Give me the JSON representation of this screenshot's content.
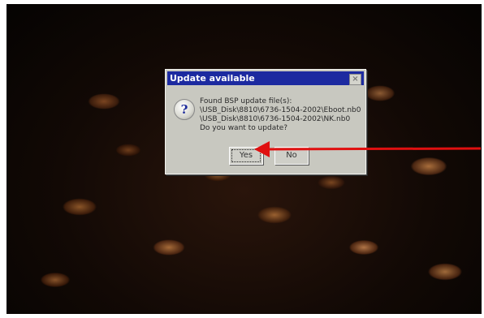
{
  "dialog": {
    "title": "Update available",
    "close_label": "×",
    "icon": "question-icon",
    "lines": [
      "Found BSP update file(s):",
      "\\USB_Disk\\8810\\6736-1504-2002\\Eboot.nb0",
      "\\USB_Disk\\8810\\6736-1504-2002\\NK.nb0",
      "Do you want to update?"
    ],
    "yes_label": "Yes",
    "no_label": "No"
  },
  "annotation": {
    "arrow_color": "#e01010",
    "arrow_target": "yes-button"
  }
}
